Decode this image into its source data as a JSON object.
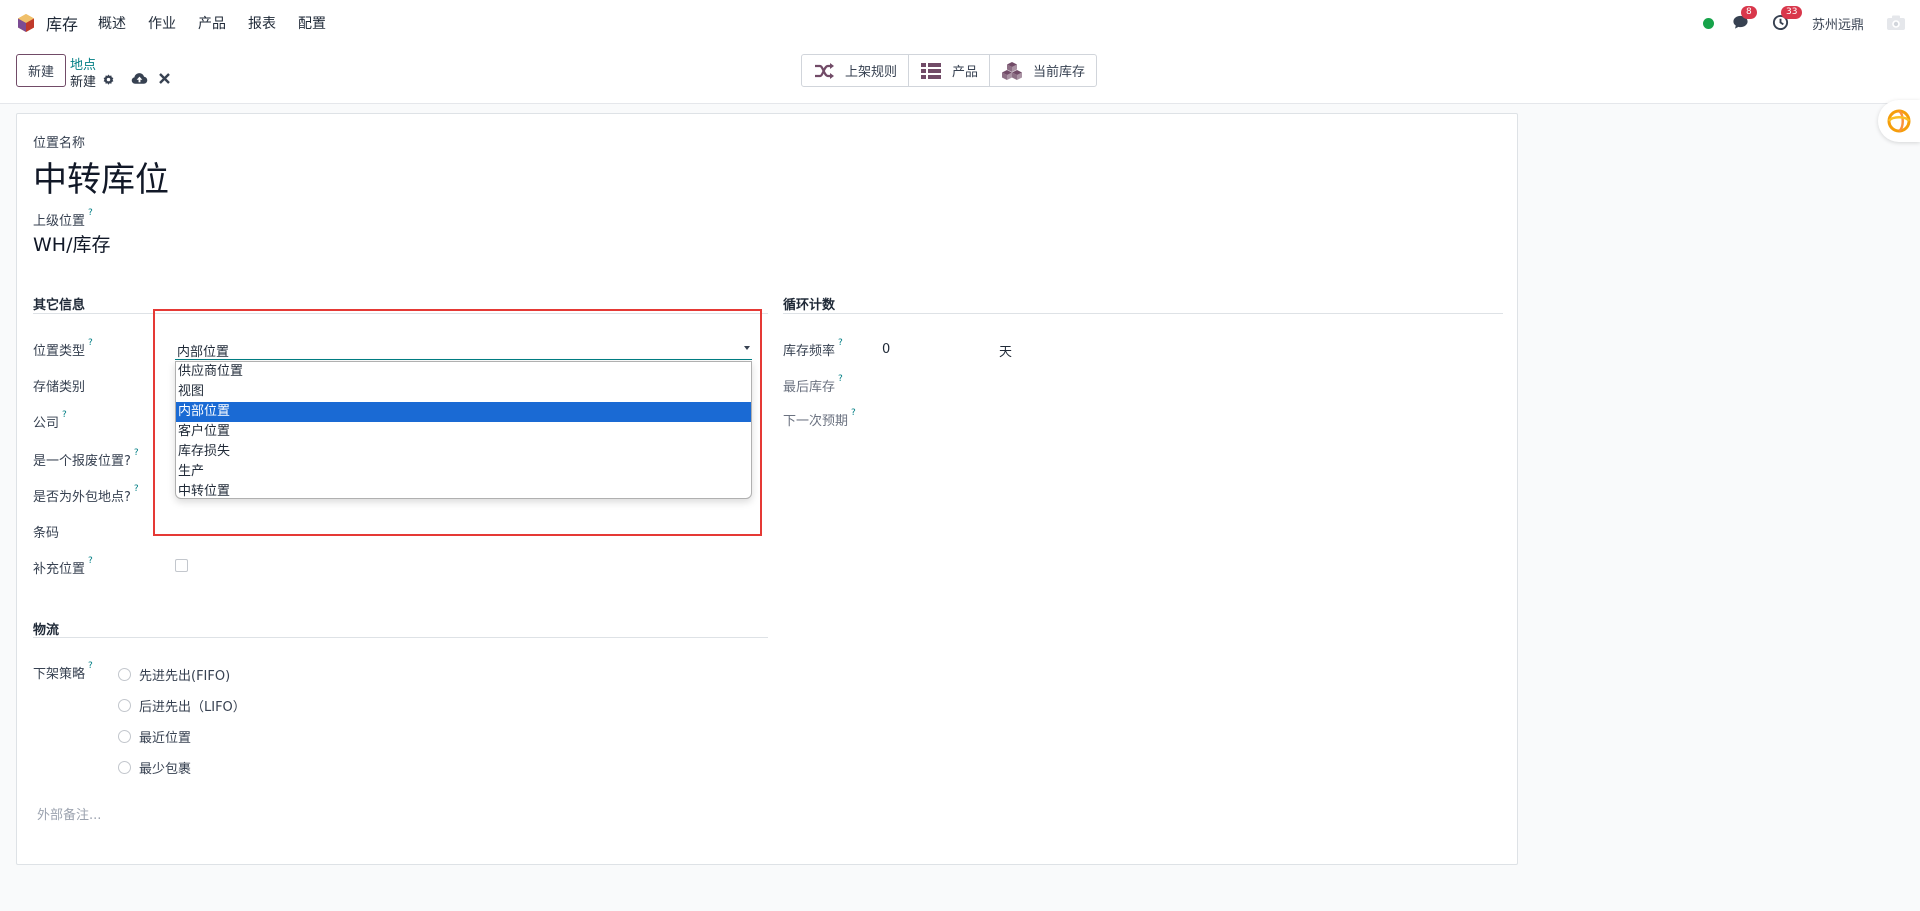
{
  "nav": {
    "app_name": "库存",
    "menu": [
      "概述",
      "作业",
      "产品",
      "报表",
      "配置"
    ],
    "messages_count": "8",
    "activities_count": "33",
    "company": "苏州远鼎"
  },
  "control": {
    "new_label": "新建",
    "breadcrumb_parent": "地点",
    "breadcrumb_current": "新建",
    "smart_buttons": [
      "上架规则",
      "产品",
      "当前库存"
    ]
  },
  "form": {
    "name_label": "位置名称",
    "name_value": "中转库位",
    "parent_label": "上级位置",
    "parent_value": "WH/库存",
    "help_mark": "?",
    "group_other": "其它信息",
    "group_cycle": "循环计数",
    "group_logistics": "物流",
    "location_type_label": "位置类型",
    "location_type_value": "内部位置",
    "storage_category_label": "存储类别",
    "company_label": "公司",
    "scrap_label": "是一个报废位置?",
    "subcontract_label": "是否为外包地点?",
    "barcode_label": "条码",
    "replenish_label": "补充位置",
    "cyclic_freq_label": "库存频率",
    "cyclic_freq_value": "0",
    "cyclic_freq_unit": "天",
    "last_inventory_label": "最后库存",
    "next_expected_label": "下一次预期",
    "removal_label": "下架策略",
    "removal_options": [
      "先进先出(FIFO)",
      "后进先出（LIFO）",
      "最近位置",
      "最少包裹"
    ],
    "notes_placeholder": "外部备注..."
  },
  "dropdown": {
    "options": [
      "供应商位置",
      "视图",
      "内部位置",
      "客户位置",
      "库存损失",
      "生产",
      "中转位置"
    ],
    "selected_index": 2
  },
  "colors": {
    "brand": "#714b67",
    "link": "#017e84",
    "selection": "#1a6ad4",
    "highlight": "#e53935",
    "badge": "#d9374b"
  }
}
